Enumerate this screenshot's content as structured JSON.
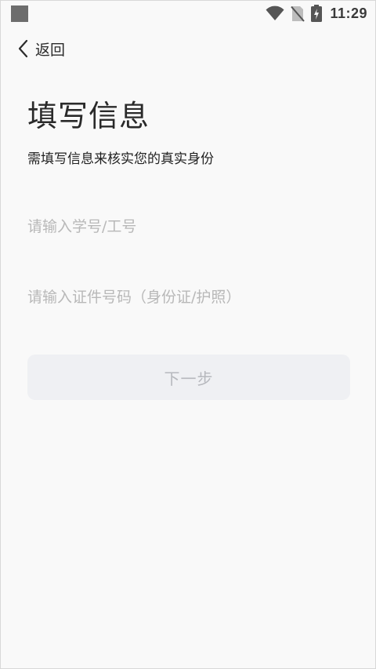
{
  "status_bar": {
    "time": "11:29",
    "icons": [
      "app-notification-icon",
      "wifi-icon",
      "no-sim-icon",
      "battery-charging-icon"
    ]
  },
  "header": {
    "back_label": "返回"
  },
  "main": {
    "title": "填写信息",
    "subtitle": "需填写信息来核实您的真实身份",
    "student_id_placeholder": "请输入学号/工号",
    "id_number_placeholder": "请输入证件号码（身份证/护照）",
    "next_label": "下一步"
  },
  "colors": {
    "background": "#f9f9f9",
    "button_bg": "#eff0f3",
    "button_text": "#b6b8bd",
    "placeholder": "#b8b8b8"
  }
}
